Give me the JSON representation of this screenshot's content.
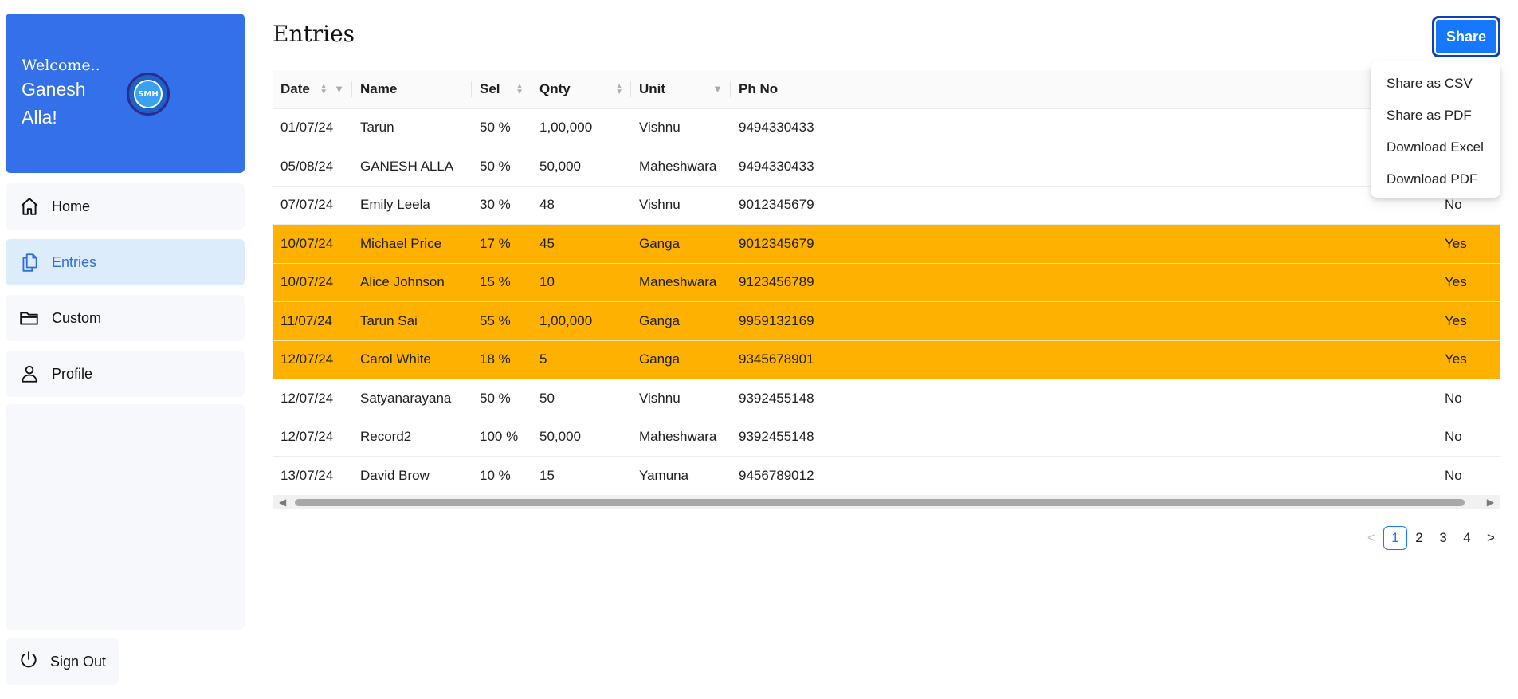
{
  "sidebar": {
    "welcome": "Welcome..",
    "user_name": "Ganesh Alla!",
    "logo_text": "SMH",
    "nav": [
      {
        "label": "Home",
        "icon": "home-icon"
      },
      {
        "label": "Entries",
        "icon": "documents-icon"
      },
      {
        "label": "Custom",
        "icon": "folder-icon"
      },
      {
        "label": "Profile",
        "icon": "user-icon"
      }
    ],
    "sign_out": "Sign Out"
  },
  "main": {
    "title": "Entries",
    "share_label": "Share",
    "share_menu": [
      "Share as CSV",
      "Share as PDF",
      "Download Excel",
      "Download PDF"
    ],
    "columns": [
      "Date",
      "Name",
      "Sel",
      "Qnty",
      "Unit",
      "Ph No"
    ],
    "rows": [
      {
        "date": "01/07/24",
        "name": "Tarun",
        "sel": "50 %",
        "qnty": "1,00,000",
        "unit": "Vishnu",
        "phone": "9494330433",
        "last": "",
        "highlight": false
      },
      {
        "date": "05/08/24",
        "name": "GANESH ALLA",
        "sel": "50 %",
        "qnty": "50,000",
        "unit": "Maheshwara",
        "phone": "9494330433",
        "last": "",
        "highlight": false
      },
      {
        "date": "07/07/24",
        "name": "Emily Leela",
        "sel": "30 %",
        "qnty": "48",
        "unit": "Vishnu",
        "phone": "9012345679",
        "last": "No",
        "highlight": false
      },
      {
        "date": "10/07/24",
        "name": "Michael Price",
        "sel": "17 %",
        "qnty": "45",
        "unit": "Ganga",
        "phone": "9012345679",
        "last": "Yes",
        "highlight": true
      },
      {
        "date": "10/07/24",
        "name": "Alice Johnson",
        "sel": "15 %",
        "qnty": "10",
        "unit": "Maneshwara",
        "phone": "9123456789",
        "last": "Yes",
        "highlight": true
      },
      {
        "date": "11/07/24",
        "name": "Tarun Sai",
        "sel": "55 %",
        "qnty": "1,00,000",
        "unit": "Ganga",
        "phone": "9959132169",
        "last": "Yes",
        "highlight": true
      },
      {
        "date": "12/07/24",
        "name": "Carol White",
        "sel": "18 %",
        "qnty": "5",
        "unit": "Ganga",
        "phone": "9345678901",
        "last": "Yes",
        "highlight": true
      },
      {
        "date": "12/07/24",
        "name": "Satyanarayana",
        "sel": "50 %",
        "qnty": "50",
        "unit": "Vishnu",
        "phone": "9392455148",
        "last": "No",
        "highlight": false
      },
      {
        "date": "12/07/24",
        "name": "Record2",
        "sel": "100 %",
        "qnty": "50,000",
        "unit": "Maheshwara",
        "phone": "9392455148",
        "last": "No",
        "highlight": false
      },
      {
        "date": "13/07/24",
        "name": "David Brow",
        "sel": "10 %",
        "qnty": "15",
        "unit": "Yamuna",
        "phone": "9456789012",
        "last": "No",
        "highlight": false
      }
    ],
    "pagination": {
      "prev": "<",
      "pages": [
        "1",
        "2",
        "3",
        "4"
      ],
      "next": ">",
      "current": "1"
    }
  },
  "colors": {
    "brand": "#3370e9",
    "highlight_row": "#ffb100",
    "accent": "#1677ff"
  }
}
